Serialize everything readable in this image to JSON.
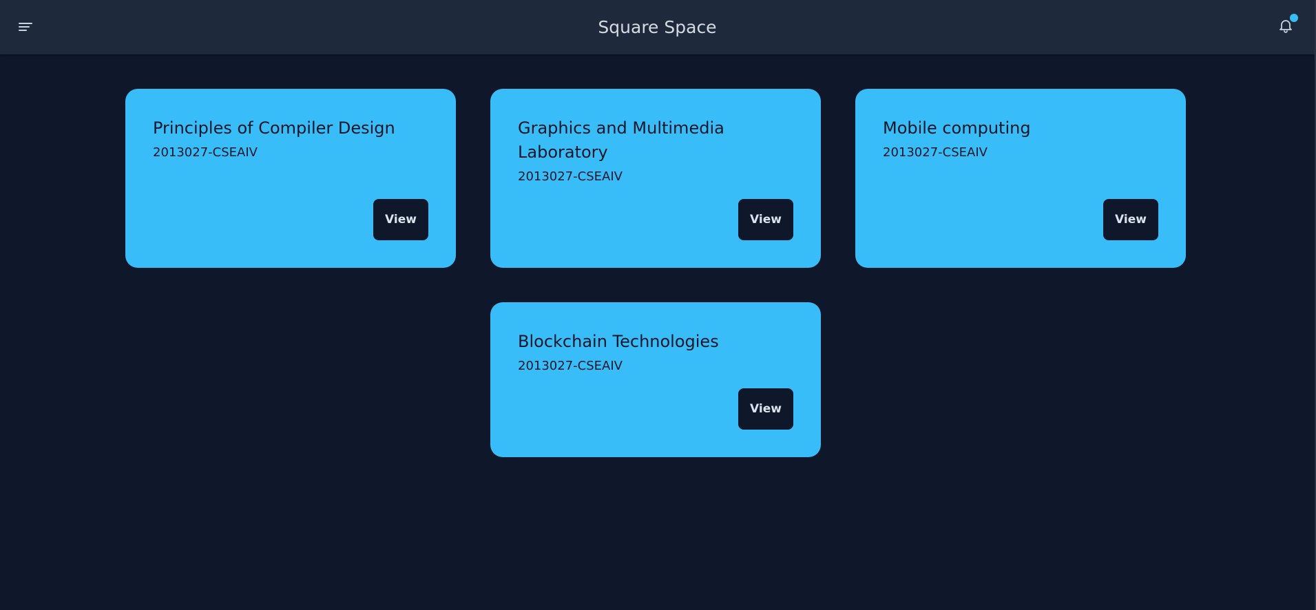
{
  "app": {
    "title": "Square Space"
  },
  "header": {
    "menu_icon": "hamburger-menu-icon",
    "notification_icon": "bell-icon",
    "has_notification": true,
    "accent_color": "#38bdf8"
  },
  "theme": {
    "background": "#0f172a",
    "navbar": "#1e293b",
    "card": "#38bdf8",
    "button": "#0f172a"
  },
  "courses": [
    {
      "title": "Principles of Compiler Design",
      "code": "2013027-CSEAIV",
      "action_label": "View"
    },
    {
      "title": "Graphics and Multimedia Laboratory",
      "code": "2013027-CSEAIV",
      "action_label": "View"
    },
    {
      "title": "Mobile computing",
      "code": "2013027-CSEAIV",
      "action_label": "View"
    },
    {
      "title": "Blockchain Technologies",
      "code": "2013027-CSEAIV",
      "action_label": "View"
    }
  ]
}
